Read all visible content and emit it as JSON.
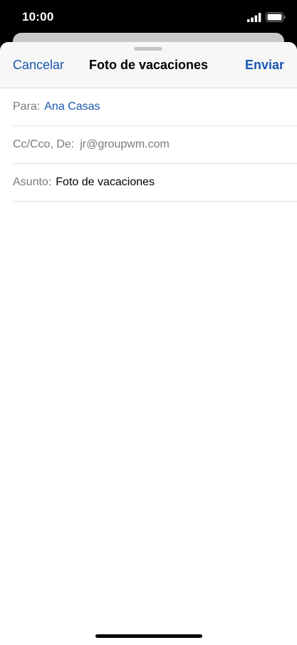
{
  "status_bar": {
    "time": "10:00"
  },
  "compose": {
    "cancel_label": "Cancelar",
    "title": "Foto de vacaciones",
    "send_label": "Enviar",
    "fields": {
      "to_label": "Para:",
      "to_value": "Ana Casas",
      "cc_label": "Cc/Cco, De:",
      "cc_value": "jr@groupwm.com",
      "subject_label": "Asunto:",
      "subject_value": "Foto de vacaciones"
    }
  },
  "colors": {
    "accent": "#1a56b0",
    "label_gray": "#7a7a7f",
    "nav_background": "#f7f7f7"
  },
  "icons": {
    "signal": "cellular-signal-icon",
    "battery": "battery-icon",
    "grabber": "sheet-grabber"
  }
}
